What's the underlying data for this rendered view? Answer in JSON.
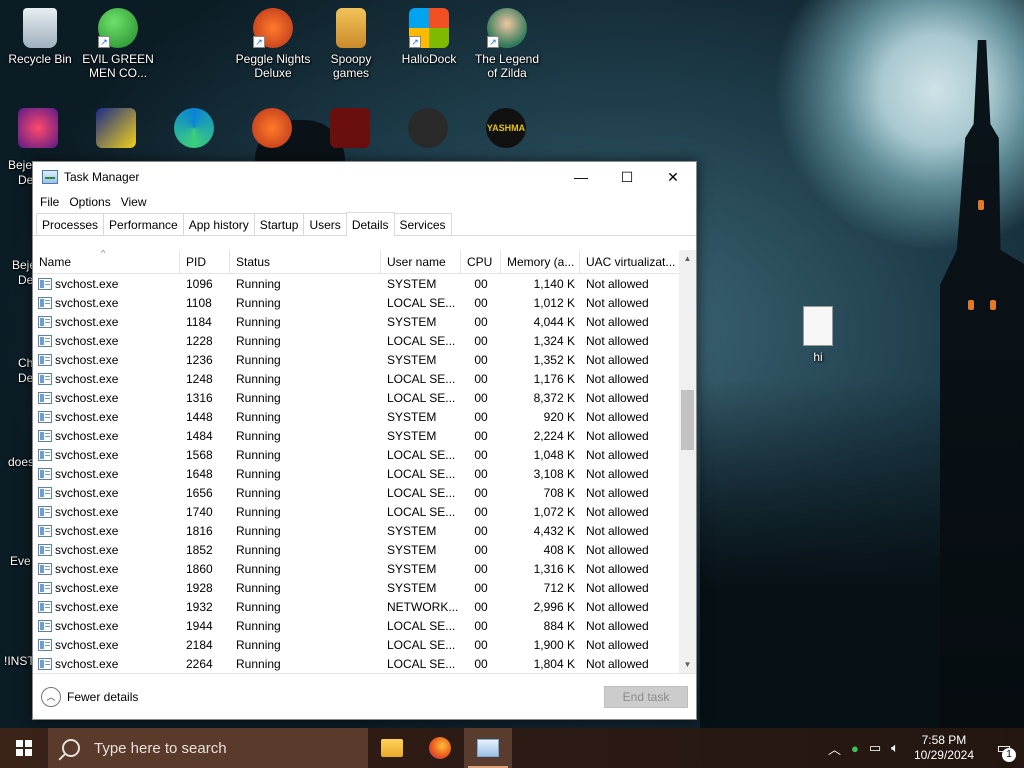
{
  "desktop": {
    "icons": [
      {
        "label": "Recycle Bin",
        "icon": "recycle-bin-icon"
      },
      {
        "label": "EVIL GREEN MEN CO...",
        "icon": "green-men-icon"
      },
      {
        "label": "Peggle Nights Deluxe",
        "icon": "peggle-icon"
      },
      {
        "label": "Spoopy games",
        "icon": "folder-icon"
      },
      {
        "label": "HalloDock",
        "icon": "windows-logo-icon"
      },
      {
        "label": "The Legend of Zilda",
        "icon": "zilda-icon"
      },
      {
        "label": "hi",
        "icon": "text-file-icon"
      }
    ],
    "partial_labels": [
      "Beje",
      "De",
      "Beje",
      "De",
      "Ch",
      "De",
      "does",
      "Eve",
      "!INST"
    ],
    "partial_icon_row": [
      "bejeweled-icon",
      "mpl-icon",
      "edge-icon",
      "peggle-icon",
      "flash-icon",
      "prefs-icon",
      "yashma-icon"
    ],
    "yashma_text": "YASHMA"
  },
  "window": {
    "title": "Task Manager",
    "controls": {
      "minimize": "—",
      "maximize": "☐",
      "close": "✕"
    },
    "menu": [
      "File",
      "Options",
      "View"
    ],
    "tabs": [
      "Processes",
      "Performance",
      "App history",
      "Startup",
      "Users",
      "Details",
      "Services"
    ],
    "active_tab": "Details",
    "columns": [
      "Name",
      "PID",
      "Status",
      "User name",
      "CPU",
      "Memory (a...",
      "UAC virtualizat..."
    ],
    "rows": [
      [
        "svchost.exe",
        "1096",
        "Running",
        "SYSTEM",
        "00",
        "1,140 K",
        "Not allowed"
      ],
      [
        "svchost.exe",
        "1108",
        "Running",
        "LOCAL SE...",
        "00",
        "1,012 K",
        "Not allowed"
      ],
      [
        "svchost.exe",
        "1184",
        "Running",
        "SYSTEM",
        "00",
        "4,044 K",
        "Not allowed"
      ],
      [
        "svchost.exe",
        "1228",
        "Running",
        "LOCAL SE...",
        "00",
        "1,324 K",
        "Not allowed"
      ],
      [
        "svchost.exe",
        "1236",
        "Running",
        "SYSTEM",
        "00",
        "1,352 K",
        "Not allowed"
      ],
      [
        "svchost.exe",
        "1248",
        "Running",
        "LOCAL SE...",
        "00",
        "1,176 K",
        "Not allowed"
      ],
      [
        "svchost.exe",
        "1316",
        "Running",
        "LOCAL SE...",
        "00",
        "8,372 K",
        "Not allowed"
      ],
      [
        "svchost.exe",
        "1448",
        "Running",
        "SYSTEM",
        "00",
        "920 K",
        "Not allowed"
      ],
      [
        "svchost.exe",
        "1484",
        "Running",
        "SYSTEM",
        "00",
        "2,224 K",
        "Not allowed"
      ],
      [
        "svchost.exe",
        "1568",
        "Running",
        "LOCAL SE...",
        "00",
        "1,048 K",
        "Not allowed"
      ],
      [
        "svchost.exe",
        "1648",
        "Running",
        "LOCAL SE...",
        "00",
        "3,108 K",
        "Not allowed"
      ],
      [
        "svchost.exe",
        "1656",
        "Running",
        "LOCAL SE...",
        "00",
        "708 K",
        "Not allowed"
      ],
      [
        "svchost.exe",
        "1740",
        "Running",
        "LOCAL SE...",
        "00",
        "1,072 K",
        "Not allowed"
      ],
      [
        "svchost.exe",
        "1816",
        "Running",
        "SYSTEM",
        "00",
        "4,432 K",
        "Not allowed"
      ],
      [
        "svchost.exe",
        "1852",
        "Running",
        "SYSTEM",
        "00",
        "408 K",
        "Not allowed"
      ],
      [
        "svchost.exe",
        "1860",
        "Running",
        "SYSTEM",
        "00",
        "1,316 K",
        "Not allowed"
      ],
      [
        "svchost.exe",
        "1928",
        "Running",
        "SYSTEM",
        "00",
        "712 K",
        "Not allowed"
      ],
      [
        "svchost.exe",
        "1932",
        "Running",
        "NETWORK...",
        "00",
        "2,996 K",
        "Not allowed"
      ],
      [
        "svchost.exe",
        "1944",
        "Running",
        "LOCAL SE...",
        "00",
        "884 K",
        "Not allowed"
      ],
      [
        "svchost.exe",
        "2184",
        "Running",
        "LOCAL SE...",
        "00",
        "1,900 K",
        "Not allowed"
      ],
      [
        "svchost.exe",
        "2264",
        "Running",
        "LOCAL SE...",
        "00",
        "1,804 K",
        "Not allowed"
      ]
    ],
    "footer": {
      "fewer_details": "Fewer details",
      "end_task": "End task"
    }
  },
  "taskbar": {
    "search_placeholder": "Type here to search",
    "apps": [
      "file-explorer-icon",
      "firefox-icon",
      "task-manager-icon"
    ],
    "time": "7:58 PM",
    "date": "10/29/2024",
    "notification_count": "1"
  },
  "colors": {
    "taskbar": "#2d1b14",
    "search": "#5a3a2a",
    "accent": "#0078d7"
  }
}
